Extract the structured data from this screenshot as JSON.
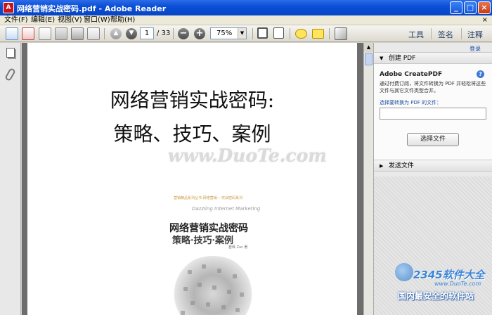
{
  "window": {
    "title": "网络营销实战密码.pdf - Adobe Reader",
    "app_icon": "adobe-reader-icon",
    "controls": {
      "minimize": "_",
      "maximize": "□",
      "close": "×"
    }
  },
  "menu": {
    "items": [
      "文件(F)",
      "编辑(E)",
      "视图(V)",
      "窗口(W)",
      "帮助(H)"
    ],
    "close_glyph": "×"
  },
  "toolbar": {
    "page_current": "1",
    "page_total": "/ 33",
    "zoom": "75%",
    "zoom_out_glyph": "−",
    "zoom_in_glyph": "+",
    "tabs": [
      "工具",
      "签名",
      "注释"
    ]
  },
  "document": {
    "title_line1": "网络营销实战密码:",
    "title_line2": "策略、技巧、案例",
    "watermark": "www.DuoTe.com",
    "cover": {
      "series": "营销精品系列丛书·网络营销·—实战密码系列",
      "subtitle_en": "Dazzling Internet Marketing",
      "title": "网络营销实战密码",
      "subtitle": "策略·技巧·案例",
      "author": "昝辉 Zac 著"
    }
  },
  "right_panel": {
    "login": "登录",
    "create_pdf_header": "创建 PDF",
    "create_pdf_title": "Adobe CreatePDF",
    "description": "通过付费订阅，将文件转换为 PDF 并轻松将这些文件与其它文件类型合并。",
    "select_label": "选择要转换为 PDF 的文件：",
    "file_value": "",
    "choose_button": "选择文件",
    "send_files_header": "发送文件"
  },
  "overlay": {
    "brand": "2345软件大全",
    "url": "www.DuoTe.com",
    "slogan": "国内最安全的软件站"
  },
  "colors": {
    "titlebar": "#0a4fd6",
    "accent": "#3c86d8"
  }
}
